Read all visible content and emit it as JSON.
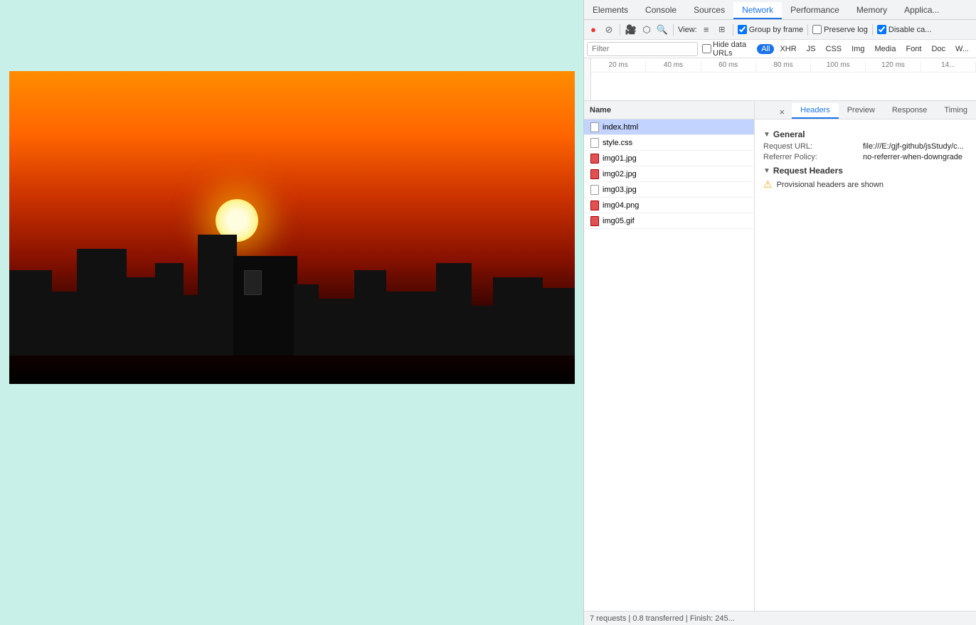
{
  "webpage": {
    "bg_color": "#c8f0e8",
    "slideshow": {
      "dots": [
        {
          "active": true
        },
        {
          "active": false
        },
        {
          "active": false
        },
        {
          "active": false
        },
        {
          "active": false
        }
      ]
    }
  },
  "devtools": {
    "tabs": [
      {
        "label": "Elements",
        "active": false
      },
      {
        "label": "Console",
        "active": false
      },
      {
        "label": "Sources",
        "active": false
      },
      {
        "label": "Network",
        "active": true
      },
      {
        "label": "Performance",
        "active": false
      },
      {
        "label": "Memory",
        "active": false
      },
      {
        "label": "Applica...",
        "active": false
      }
    ],
    "toolbar": {
      "record_label": "●",
      "stop_label": "⊘",
      "camera_label": "📷",
      "filter_label": "⬡",
      "search_label": "🔍",
      "view_label": "View:",
      "list_view_label": "≡",
      "group_by_frame_label": "Group by frame",
      "preserve_log_label": "Preserve log",
      "disable_cache_label": "Disable ca..."
    },
    "filter_bar": {
      "placeholder": "Filter",
      "hide_data_urls_label": "Hide data URLs",
      "type_buttons": [
        "All",
        "XHR",
        "JS",
        "CSS",
        "Img",
        "Media",
        "Font",
        "Doc",
        "W..."
      ]
    },
    "timeline": {
      "ticks": [
        "20 ms",
        "40 ms",
        "60 ms",
        "80 ms",
        "100 ms",
        "120 ms",
        "14..."
      ]
    },
    "name_list": {
      "header": "Name",
      "items": [
        {
          "name": "index.html",
          "icon": "white",
          "selected": true
        },
        {
          "name": "style.css",
          "icon": "white",
          "selected": false
        },
        {
          "name": "img01.jpg",
          "icon": "red",
          "selected": false
        },
        {
          "name": "img02.jpg",
          "icon": "red",
          "selected": false
        },
        {
          "name": "img03.jpg",
          "icon": "white",
          "selected": false
        },
        {
          "name": "img04.png",
          "icon": "red",
          "selected": false
        },
        {
          "name": "img05.gif",
          "icon": "red",
          "selected": false
        }
      ]
    },
    "detail": {
      "tabs": [
        {
          "label": "Headers",
          "active": true
        },
        {
          "label": "Preview",
          "active": false
        },
        {
          "label": "Response",
          "active": false
        },
        {
          "label": "Timing",
          "active": false
        }
      ],
      "general": {
        "section_title": "General",
        "request_url_key": "Request URL:",
        "request_url_value": "file:///E:/gjf-github/jsStudy/c...",
        "referrer_policy_key": "Referrer Policy:",
        "referrer_policy_value": "no-referrer-when-downgrade"
      },
      "request_headers": {
        "section_title": "Request Headers",
        "warning_text": "Provisional headers are shown"
      }
    },
    "status_bar": {
      "text": "7 requests  |  0.8 transferred  |  Finish: 245..."
    }
  }
}
